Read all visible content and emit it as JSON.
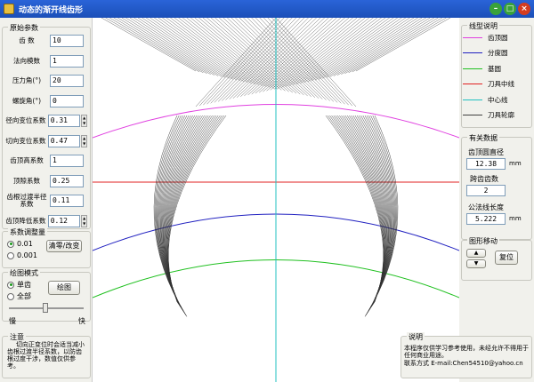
{
  "window": {
    "title": "动态的渐开线齿形"
  },
  "params": {
    "title": "原始参数",
    "rows": [
      {
        "label": "齿  数",
        "value": "10",
        "spin": false
      },
      {
        "label": "法向模数",
        "value": "1",
        "spin": false
      },
      {
        "label": "压力角(°)",
        "value": "20",
        "spin": false
      },
      {
        "label": "螺旋角(°)",
        "value": "0",
        "spin": false
      },
      {
        "label": "径向变位系数",
        "value": "0.31",
        "spin": true
      },
      {
        "label": "切向变位系数",
        "value": "0.47",
        "spin": true
      },
      {
        "label": "齿顶高系数",
        "value": "1",
        "spin": false
      },
      {
        "label": "顶隙系数",
        "value": "0.25",
        "spin": false
      },
      {
        "label": "齿根过渡半径系数",
        "value": "0.11",
        "spin": false
      },
      {
        "label": "齿顶降低系数",
        "value": "0.12",
        "spin": true
      }
    ]
  },
  "step": {
    "title": "系数调整量",
    "opt1": "0.01",
    "opt2": "0.001",
    "button": "清零/改变"
  },
  "mode": {
    "title": "绘图模式",
    "opt1": "单齿",
    "opt2": "全部",
    "button": "绘图",
    "slow": "慢",
    "fast": "快"
  },
  "note": {
    "title": "注意",
    "text": "切向正变位时会适当减小齿根过渡半径系数，以防齿根过度干涉，数值仅供参考。"
  },
  "legend": {
    "title": "线型说明",
    "items": [
      {
        "label": "齿顶圆",
        "color": "#e040e0"
      },
      {
        "label": "分度圆",
        "color": "#2020c0"
      },
      {
        "label": "基圆",
        "color": "#20c020"
      },
      {
        "label": "刀具中线",
        "color": "#e02020"
      },
      {
        "label": "中心线",
        "color": "#20c0c0"
      },
      {
        "label": "刀具轮廓",
        "color": "#404040"
      }
    ]
  },
  "data": {
    "title": "有关数据",
    "tip_diameter_label": "齿顶圆直径",
    "tip_diameter": "12.38",
    "tip_unit": "mm",
    "span_teeth_label": "跨齿齿数",
    "span_teeth": "2",
    "normal_length_label": "公法线长度",
    "normal_length": "5.222",
    "length_unit": "mm"
  },
  "move": {
    "title": "图形移动",
    "reset": "复位"
  },
  "info": {
    "title": "说明",
    "line1": "本程序仅供学习参考使用，未经允许不得用于任何商业用途。",
    "line2": "联系方式 E-mail:Chen54510@yahoo.cn"
  }
}
